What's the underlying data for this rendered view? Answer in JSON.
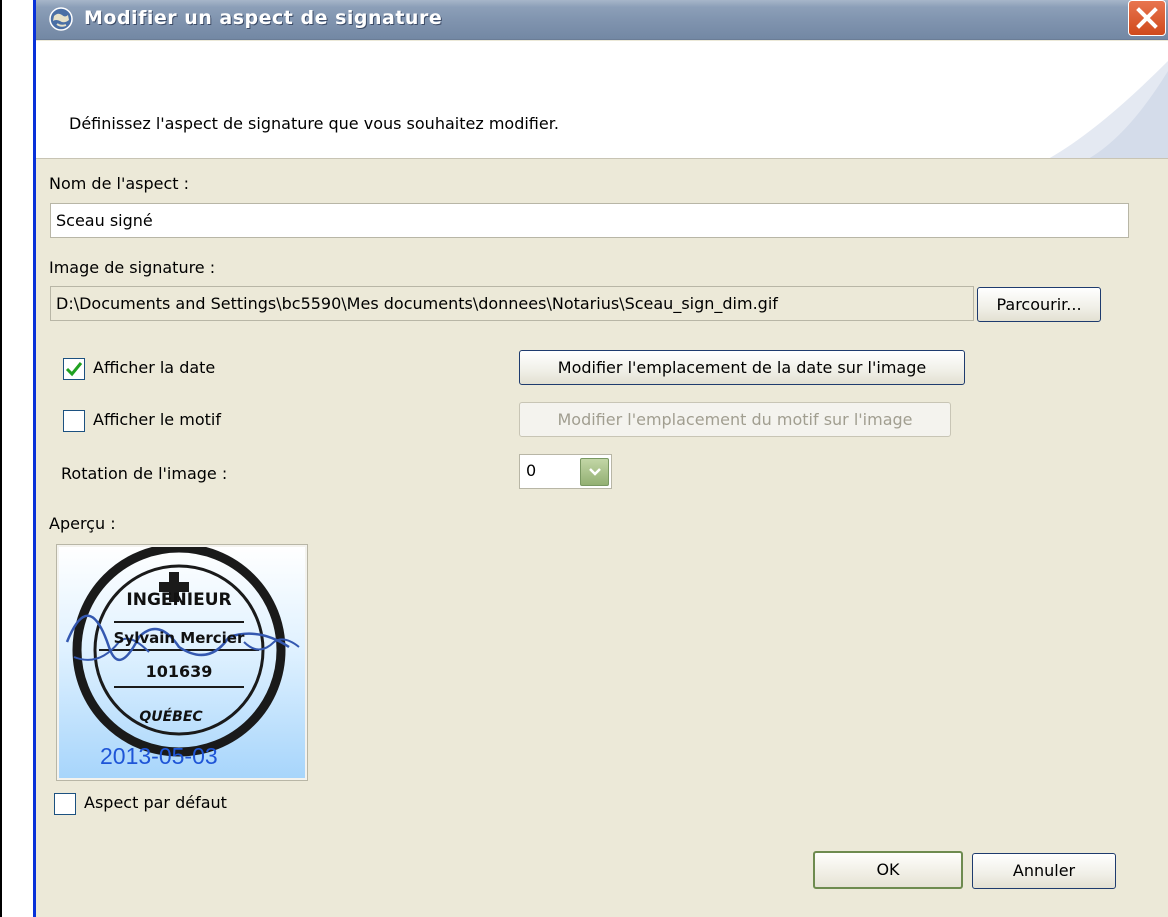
{
  "window": {
    "title": "Modifier un aspect de signature"
  },
  "header": {
    "description": "Définissez l'aspect de signature que vous souhaitez modifier."
  },
  "form": {
    "name_label": "Nom de l'aspect :",
    "name_value": "Sceau signé",
    "image_label": "Image de signature :",
    "image_path": "D:\\Documents and Settings\\bc5590\\Mes documents\\donnees\\Notarius\\Sceau_sign_dim.gif",
    "browse_button": "Parcourir...",
    "show_date_label": "Afficher la date",
    "show_date_checked": true,
    "date_position_button": "Modifier l'emplacement de la date sur l'image",
    "show_reason_label": "Afficher le motif",
    "show_reason_checked": false,
    "reason_position_button": "Modifier l'emplacement du motif sur l'image",
    "rotation_label": "Rotation de l'image :",
    "rotation_value": "0",
    "preview_label": "Aperçu :",
    "default_aspect_label": "Aspect par défaut",
    "default_aspect_checked": false
  },
  "preview": {
    "seal_top_text": "INGENIEUR",
    "seal_name": "Sylvain Mercier",
    "seal_number": "101639",
    "seal_bottom_text": "QUÉBEC",
    "date_text": "2013-05-03"
  },
  "buttons": {
    "ok": "OK",
    "cancel": "Annuler"
  },
  "colors": {
    "dialog_bg": "#ECE9D8",
    "titlebar": "#8c9fb8",
    "close_button": "#d04a1c",
    "preview_date": "#1e55d7",
    "checkmark": "#21a121"
  }
}
